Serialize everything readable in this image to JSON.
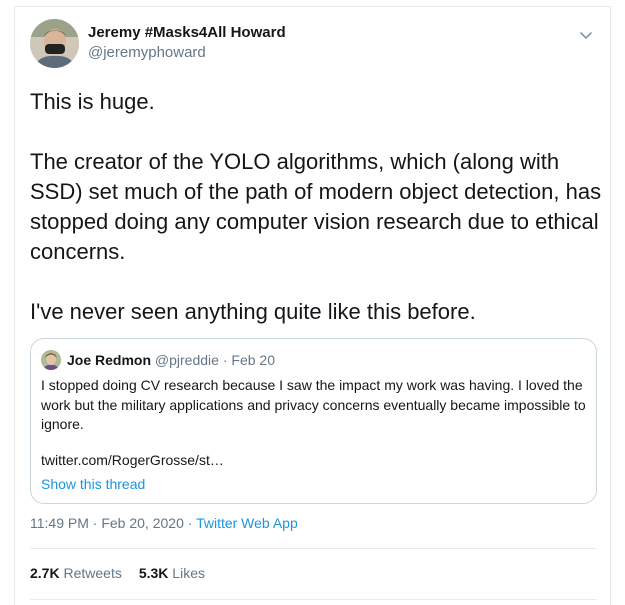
{
  "author": {
    "display_name": "Jeremy #Masks4All Howard",
    "handle": "@jeremyphoward"
  },
  "tweet": {
    "paragraphs": [
      "This is huge.",
      "The creator of the YOLO algorithms, which (along with SSD) set much of the path of modern object detection, has stopped doing any computer vision research due to ethical concerns.",
      "I've never seen anything quite like this before."
    ]
  },
  "quoted": {
    "display_name": "Joe Redmon",
    "handle": "@pjreddie",
    "separator": " · ",
    "date": "Feb 20",
    "text": "I stopped doing CV research because I saw the impact my work was having. I loved the work but the military applications and privacy concerns eventually became impossible to ignore.",
    "link": "twitter.com/RogerGrosse/st…",
    "show_thread": "Show this thread"
  },
  "meta": {
    "time": "11:49 PM",
    "separator": " · ",
    "date": "Feb 20, 2020",
    "app": "Twitter Web App"
  },
  "stats": {
    "retweets_count": "2.7K",
    "retweets_label": "Retweets",
    "likes_count": "5.3K",
    "likes_label": "Likes"
  },
  "icons": {
    "menu": "chevron-down-icon"
  },
  "colors": {
    "text": "#14171a",
    "secondary": "#657786",
    "link": "#1b95e0",
    "border": "#e6ecf0"
  }
}
